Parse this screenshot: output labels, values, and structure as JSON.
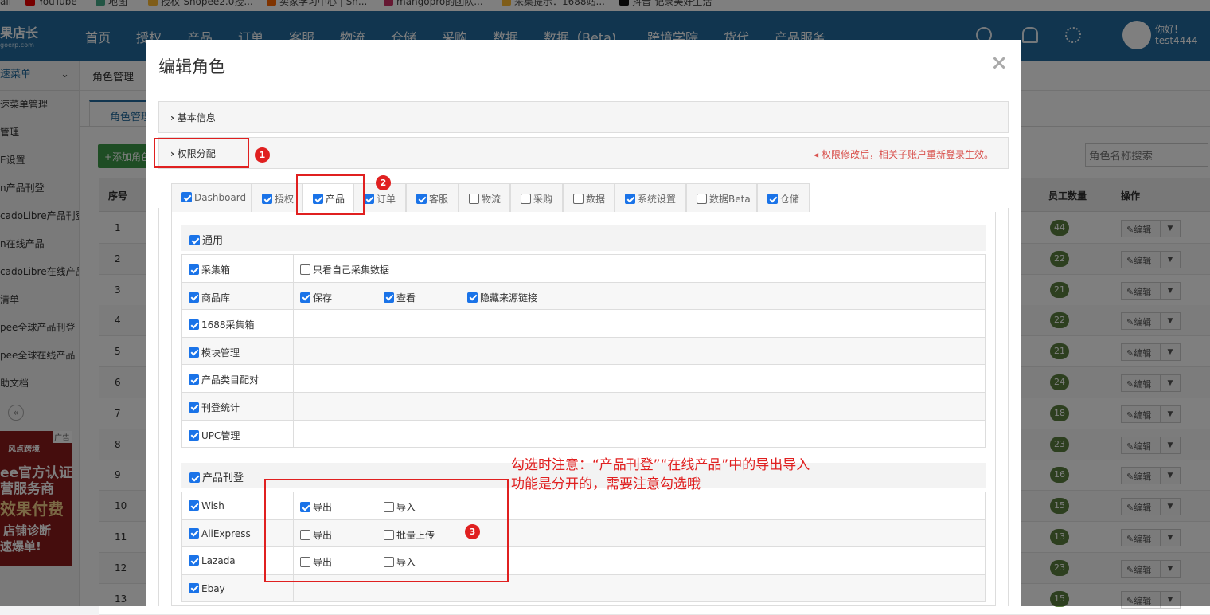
{
  "bookmarks": [
    "ail",
    "YouTube",
    "地图",
    "授权-Shopee2.0授...",
    "卖家学习中心 | Sh...",
    "mangopro的团队...",
    "采集提示：1688站...",
    "抖音-记录美好生活"
  ],
  "brand": {
    "name": "果店长",
    "sub": "goerp.com"
  },
  "nav": [
    "首页",
    "授权",
    "产品",
    "订单",
    "客服",
    "物流",
    "仓储",
    "采购",
    "数据",
    "数据（Beta)",
    "跨境学院",
    "货代",
    "产品服务"
  ],
  "user": {
    "greeting": "你好!",
    "name": "test4444"
  },
  "sidebar": {
    "header": "速菜单",
    "items": [
      "速菜单管理",
      "管理",
      "E设置",
      "n产品刊登",
      "cadoLibre产品刊登",
      "n在线产品",
      "cadoLibre在线产品",
      "清单",
      "pee全球产品刊登",
      "pee全球在线产品",
      "助文档"
    ]
  },
  "ad": {
    "tag": "广告",
    "lines": [
      "风点跨境",
      "ee官方认证",
      "营服务商",
      "效果付费",
      "店铺诊断",
      "速爆单!"
    ]
  },
  "breadcrumb": "角色管理",
  "subtab": "角色管理",
  "add_button": "+添加角色",
  "search_placeholder": "角色名称搜索",
  "table": {
    "headers": {
      "no": "序号",
      "staff": "员工数量",
      "ops": "操作"
    },
    "edit_label": "编辑",
    "rows": [
      {
        "no": "1",
        "count": "44"
      },
      {
        "no": "2",
        "count": "22"
      },
      {
        "no": "3",
        "count": "21"
      },
      {
        "no": "4",
        "count": "22"
      },
      {
        "no": "5",
        "count": "21"
      },
      {
        "no": "6",
        "count": "24"
      },
      {
        "no": "7",
        "count": "18"
      },
      {
        "no": "8",
        "count": "23"
      },
      {
        "no": "9",
        "count": "16"
      },
      {
        "no": "10",
        "count": "15"
      },
      {
        "no": "11",
        "count": "13"
      },
      {
        "no": "12",
        "count": "23"
      },
      {
        "no": "13",
        "count": "15"
      }
    ]
  },
  "modal": {
    "title": "编辑角色",
    "close": "×",
    "basic_info": "基本信息",
    "permission": "权限分配",
    "warning": "权限修改后，相关子账户重新登录生效。",
    "tabs": [
      {
        "label": "Dashboard",
        "checked": true
      },
      {
        "label": "授权",
        "checked": true
      },
      {
        "label": "产品",
        "checked": true
      },
      {
        "label": "订单",
        "checked": true
      },
      {
        "label": "客服",
        "checked": true
      },
      {
        "label": "物流",
        "checked": false
      },
      {
        "label": "采购",
        "checked": false
      },
      {
        "label": "数据",
        "checked": false
      },
      {
        "label": "系统设置",
        "checked": true
      },
      {
        "label": "数据Beta",
        "checked": false
      },
      {
        "label": "仓储",
        "checked": true
      }
    ],
    "general": {
      "title": "通用",
      "rows": [
        {
          "label": "采集箱",
          "opts": [
            {
              "label": "只看自己采集数据",
              "checked": false
            }
          ]
        },
        {
          "label": "商品库",
          "opts": [
            {
              "label": "保存",
              "checked": true
            },
            {
              "label": "查看",
              "checked": true
            },
            {
              "label": "隐藏来源链接",
              "checked": true
            }
          ]
        },
        {
          "label": "1688采集箱",
          "opts": []
        },
        {
          "label": "模块管理",
          "opts": []
        },
        {
          "label": "产品类目配对",
          "opts": []
        },
        {
          "label": "刊登统计",
          "opts": []
        },
        {
          "label": "UPC管理",
          "opts": []
        }
      ]
    },
    "listing": {
      "title": "产品刊登",
      "rows": [
        {
          "label": "Wish",
          "opts": [
            {
              "label": "导出",
              "checked": true
            },
            {
              "label": "导入",
              "checked": false
            }
          ]
        },
        {
          "label": "AliExpress",
          "opts": [
            {
              "label": "导出",
              "checked": false
            },
            {
              "label": "批量上传",
              "checked": false
            }
          ]
        },
        {
          "label": "Lazada",
          "opts": [
            {
              "label": "导出",
              "checked": false
            },
            {
              "label": "导入",
              "checked": false
            }
          ]
        },
        {
          "label": "Ebay",
          "opts": []
        }
      ]
    }
  },
  "annotations": {
    "n1": "1",
    "n2": "2",
    "n3": "3",
    "note_line1": "勾选时注意：“产品刊登”“在线产品”中的导出导入",
    "note_line2": "功能是分开的，需要注意勾选哦"
  },
  "colors": {
    "primary": "#236b9e",
    "annotation": "#e02020",
    "check": "#1a73e8",
    "badge": "#5b7f3f"
  }
}
